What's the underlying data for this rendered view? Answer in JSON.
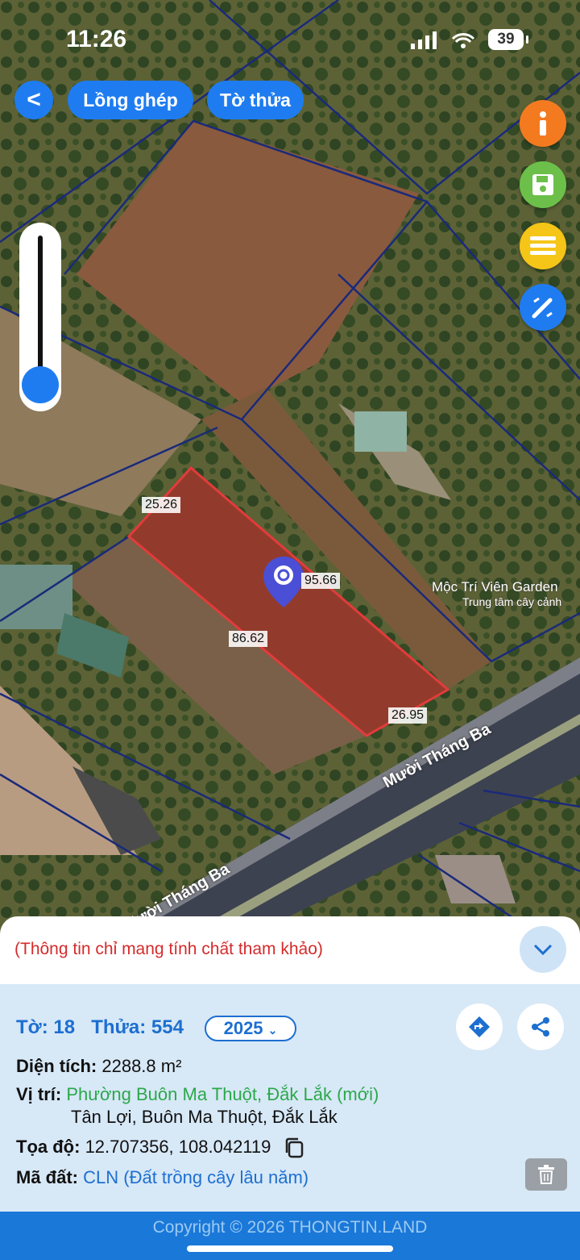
{
  "status_bar": {
    "time": "11:26",
    "battery": "39"
  },
  "toolbar": {
    "back_label": "<",
    "merge_label": "Lồng ghép",
    "sheet_label": "Tờ thửa"
  },
  "map": {
    "edge_labels": [
      "25.26",
      "95.66",
      "86.62",
      "26.95"
    ],
    "place_name": "Mộc Trí Viên Garden",
    "place_sub": "Trung tâm cây cảnh",
    "road_name_1": "Mười Tháng Ba",
    "road_name_2": "Mười Tháng Ba",
    "parcel_color": "#e23b3b",
    "boundary_color": "#1a2a7a"
  },
  "side_buttons": [
    {
      "name": "info-icon",
      "color": "#f47a20"
    },
    {
      "name": "save-icon",
      "color": "#6cc04a"
    },
    {
      "name": "list-icon",
      "color": "#f5c518"
    },
    {
      "name": "edit-map-icon",
      "color": "#1f7cf0"
    }
  ],
  "notice": {
    "text": "(Thông tin chỉ mang tính chất tham khảo)"
  },
  "parcel": {
    "sheet_label": "Tờ: 18",
    "lot_label": "Thửa: 554",
    "year": "2025",
    "area_label": "Diện tích:",
    "area_value": "2288.8 m²",
    "location_label": "Vị trí:",
    "location_new": "Phường Buôn Ma Thuột, Đắk Lắk (mới)",
    "location_old": "Tân Lợi, Buôn Ma Thuột, Đắk Lắk",
    "coord_label": "Tọa độ:",
    "coord_value": "12.707356, 108.042119",
    "land_code_label": "Mã đất:",
    "land_code_value": "CLN (Đất trồng cây lâu năm)"
  },
  "footer": {
    "copyright": "Copyright © 2026 THONGTIN.LAND"
  }
}
